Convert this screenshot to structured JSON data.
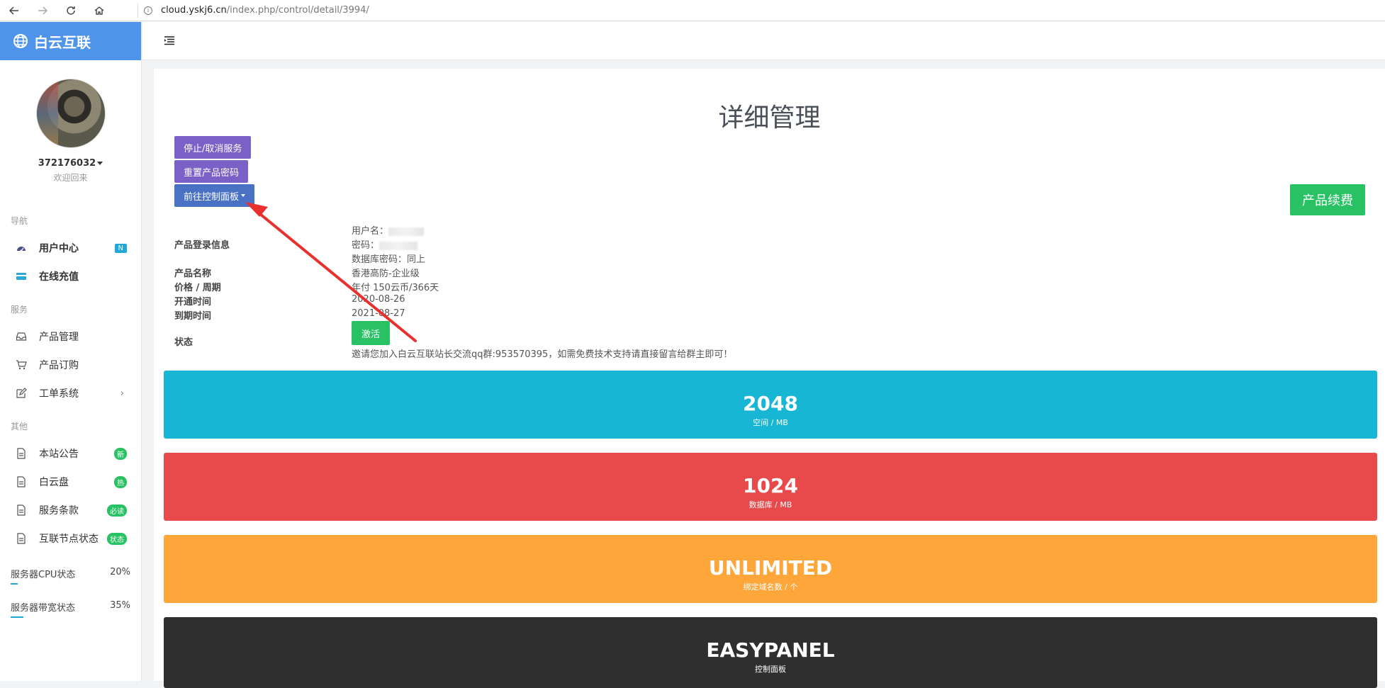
{
  "browser": {
    "url_host": "cloud.yskj6.cn",
    "url_path": "/index.php/control/detail/3994/"
  },
  "sidebar": {
    "brand": "白云互联",
    "username": "372176032",
    "welcome": "欢迎回来",
    "sections": {
      "nav": "导航",
      "service": "服务",
      "other": "其他"
    },
    "nav_items": [
      {
        "label": "用户中心",
        "badge": "N",
        "icon": "dashboard-icon"
      },
      {
        "label": "在线充值",
        "icon": "credit-card-icon"
      }
    ],
    "service_items": [
      {
        "label": "产品管理",
        "icon": "inbox-icon"
      },
      {
        "label": "产品订购",
        "icon": "cart-icon"
      },
      {
        "label": "工单系统",
        "icon": "edit-icon"
      }
    ],
    "other_items": [
      {
        "label": "本站公告",
        "badge": "新",
        "icon": "document-icon"
      },
      {
        "label": "白云盘",
        "badge": "热",
        "icon": "document-icon"
      },
      {
        "label": "服务条款",
        "badge": "必读",
        "icon": "document-icon"
      },
      {
        "label": "互联节点状态",
        "badge": "状态",
        "icon": "document-icon"
      }
    ],
    "stats": [
      {
        "label": "服务器CPU状态",
        "value": "20%",
        "fraction": 0.2
      },
      {
        "label": "服务器带宽状态",
        "value": "35%",
        "fraction": 0.35
      }
    ]
  },
  "main": {
    "title": "详细管理",
    "buttons": {
      "stop": "停止/取消服务",
      "reset": "重置产品密码",
      "panel": "前往控制面板",
      "renew": "产品续费",
      "activate": "激活"
    },
    "info": {
      "login_label": "产品登录信息",
      "username_label": "用户名：",
      "password_label": "密码：",
      "db_password": "数据库密码：同上",
      "name_label": "产品名称",
      "name_value": "香港高防-企业级",
      "price_label": "价格 / 周期",
      "price_value": "年付 150云币/366天",
      "open_label": "开通时间",
      "open_value": "2020-08-26",
      "expire_label": "到期时间",
      "expire_value": "2021-08-27",
      "status_label": "状态",
      "notice": "邀请您加入白云互联站长交流qq群:953570395，如需免费技术支持请直接留言给群主即可！"
    },
    "cards": [
      {
        "value": "2048",
        "label": "空间 / MB",
        "color": "#17b6d4"
      },
      {
        "value": "1024",
        "label": "数据库 / MB",
        "color": "#e84a4c"
      },
      {
        "value": "UNLIMITED",
        "label": "绑定域名数 / 个",
        "color": "#ffa63a"
      },
      {
        "value": "EASYPANEL",
        "label": "控制面板",
        "color": "#2f2f2f"
      }
    ]
  },
  "annotation": {
    "color": "#e8302e"
  }
}
